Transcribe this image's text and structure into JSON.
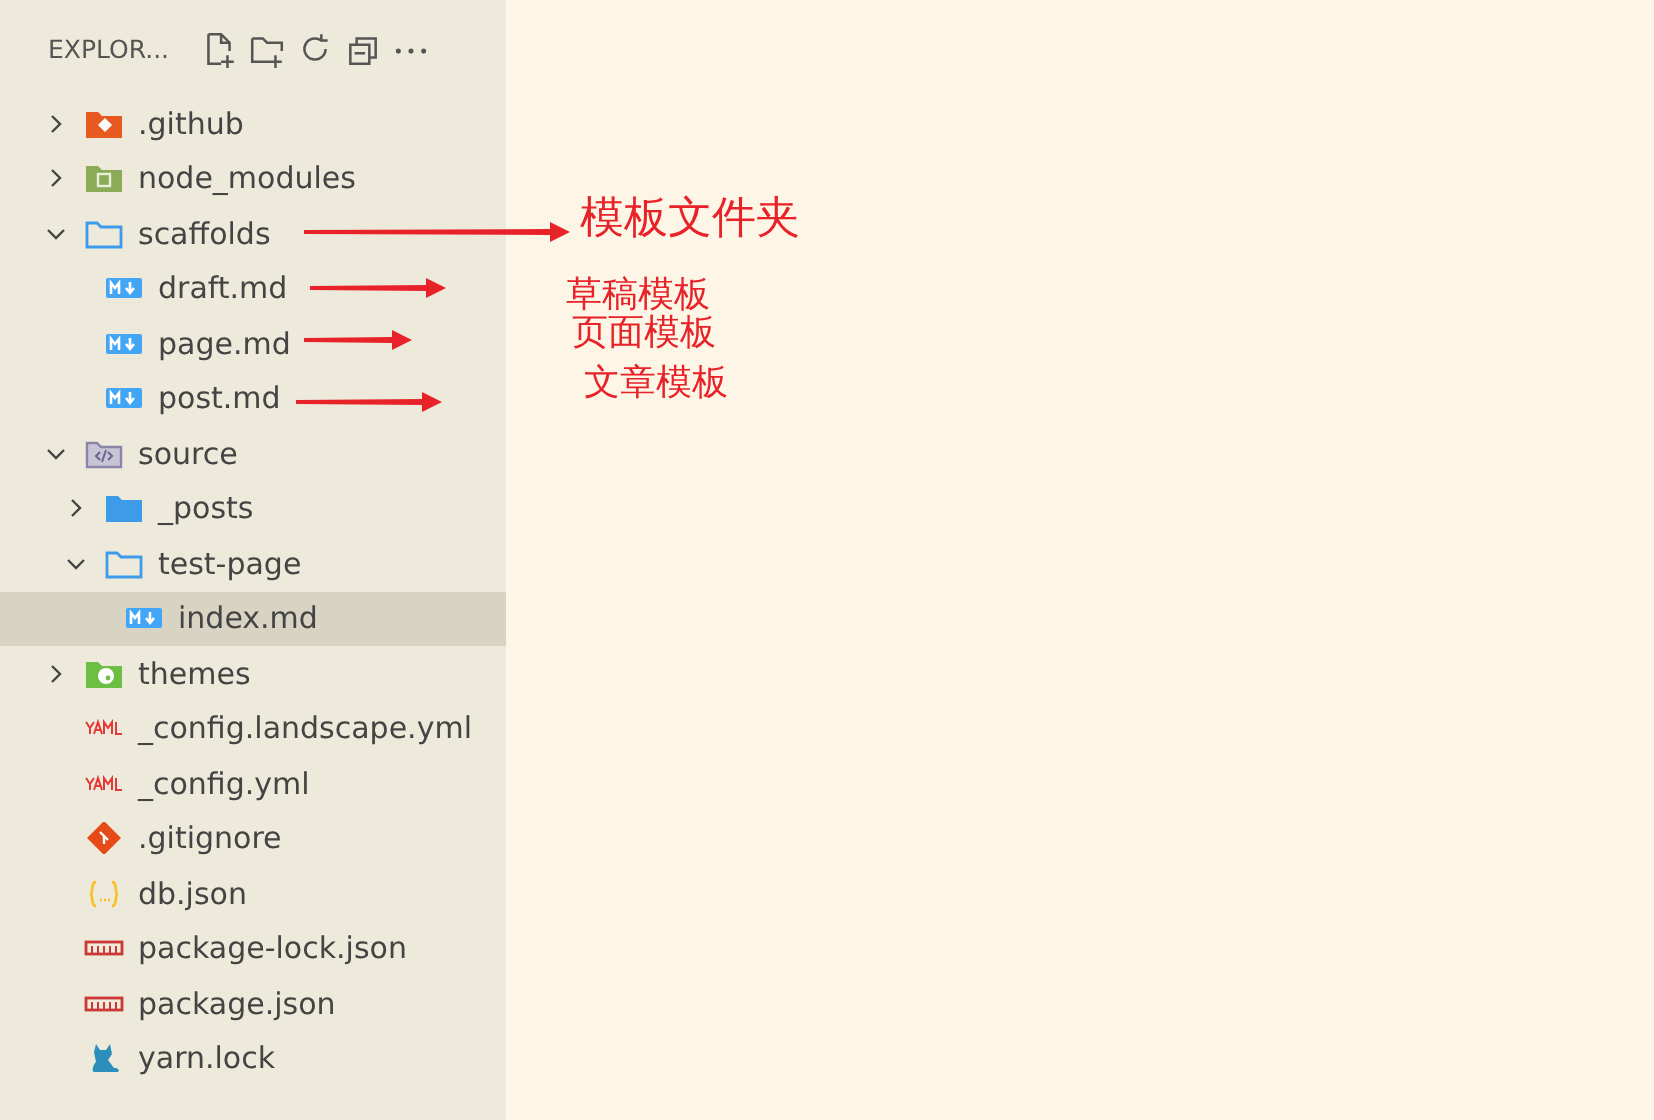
{
  "explorer": {
    "title": "EXPLOR..."
  },
  "tree": [
    {
      "name": ".github",
      "kind": "github",
      "expanded": false,
      "selected": false
    },
    {
      "name": "node_modules",
      "kind": "node",
      "expanded": false,
      "selected": false
    },
    {
      "name": "scaffolds",
      "kind": "folder",
      "expanded": true,
      "selected": false,
      "children": [
        {
          "name": "draft.md",
          "kind": "markdown",
          "selected": false
        },
        {
          "name": "page.md",
          "kind": "markdown",
          "selected": false
        },
        {
          "name": "post.md",
          "kind": "markdown",
          "selected": false
        }
      ]
    },
    {
      "name": "source",
      "kind": "source",
      "expanded": true,
      "selected": false,
      "children": [
        {
          "name": "_posts",
          "kind": "folder-filled",
          "expanded": false,
          "selected": false
        },
        {
          "name": "test-page",
          "kind": "folder",
          "expanded": true,
          "selected": false,
          "children": [
            {
              "name": "index.md",
              "kind": "markdown",
              "selected": true
            }
          ]
        }
      ]
    },
    {
      "name": "themes",
      "kind": "themes",
      "expanded": false,
      "selected": false
    },
    {
      "name": "_config.landscape.yml",
      "kind": "yaml",
      "selected": false
    },
    {
      "name": "_config.yml",
      "kind": "yaml",
      "selected": false
    },
    {
      "name": ".gitignore",
      "kind": "git",
      "selected": false
    },
    {
      "name": "db.json",
      "kind": "json",
      "selected": false
    },
    {
      "name": "package-lock.json",
      "kind": "npm",
      "selected": false
    },
    {
      "name": "package.json",
      "kind": "npm",
      "selected": false
    },
    {
      "name": "yarn.lock",
      "kind": "yarn",
      "selected": false
    }
  ],
  "annotations": [
    {
      "label": "模板文件夹"
    },
    {
      "label": "草稿模板"
    },
    {
      "label": "页面模板"
    },
    {
      "label": "文章模板"
    }
  ]
}
